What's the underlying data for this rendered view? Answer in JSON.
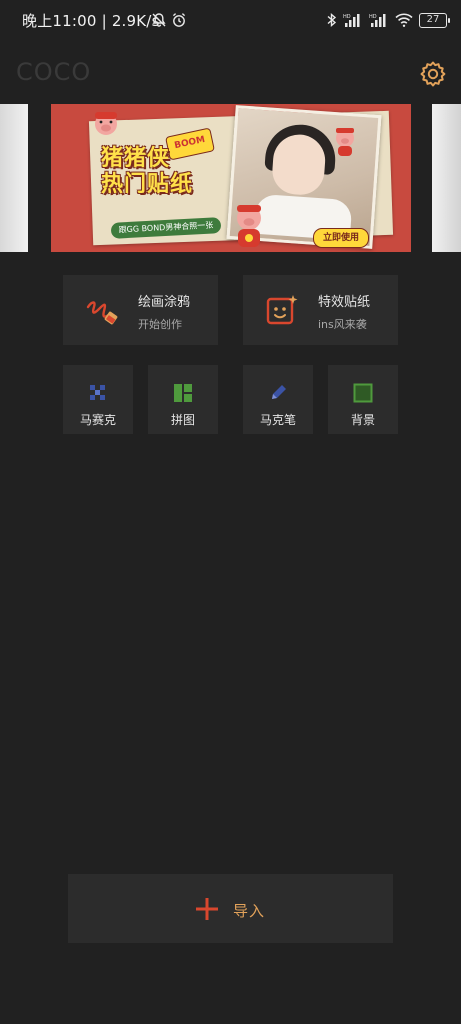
{
  "status_bar": {
    "time": "晚上11:00 | 2.9K/s",
    "battery": "27"
  },
  "header": {
    "title": "COCO"
  },
  "banner": {
    "title": "猪猪侠\n热门贴纸",
    "burst": "BOOM",
    "subtitle": "跟GG BOND男神合照一张",
    "cta": "立即使用"
  },
  "features": {
    "draw": {
      "title": "绘画涂鸦",
      "subtitle": "开始创作"
    },
    "sticker": {
      "title": "特效贴纸",
      "subtitle": "ins风来袭"
    }
  },
  "tools": [
    {
      "label": "马赛克",
      "icon": "mosaic-icon"
    },
    {
      "label": "拼图",
      "icon": "collage-icon"
    },
    {
      "label": "马克笔",
      "icon": "marker-icon"
    },
    {
      "label": "背景",
      "icon": "background-icon"
    }
  ],
  "import": {
    "label": "导入"
  },
  "colors": {
    "background": "#212121",
    "tile": "#2c2c2c",
    "accent_orange": "#e2a25a",
    "accent_red": "#d9472e"
  }
}
